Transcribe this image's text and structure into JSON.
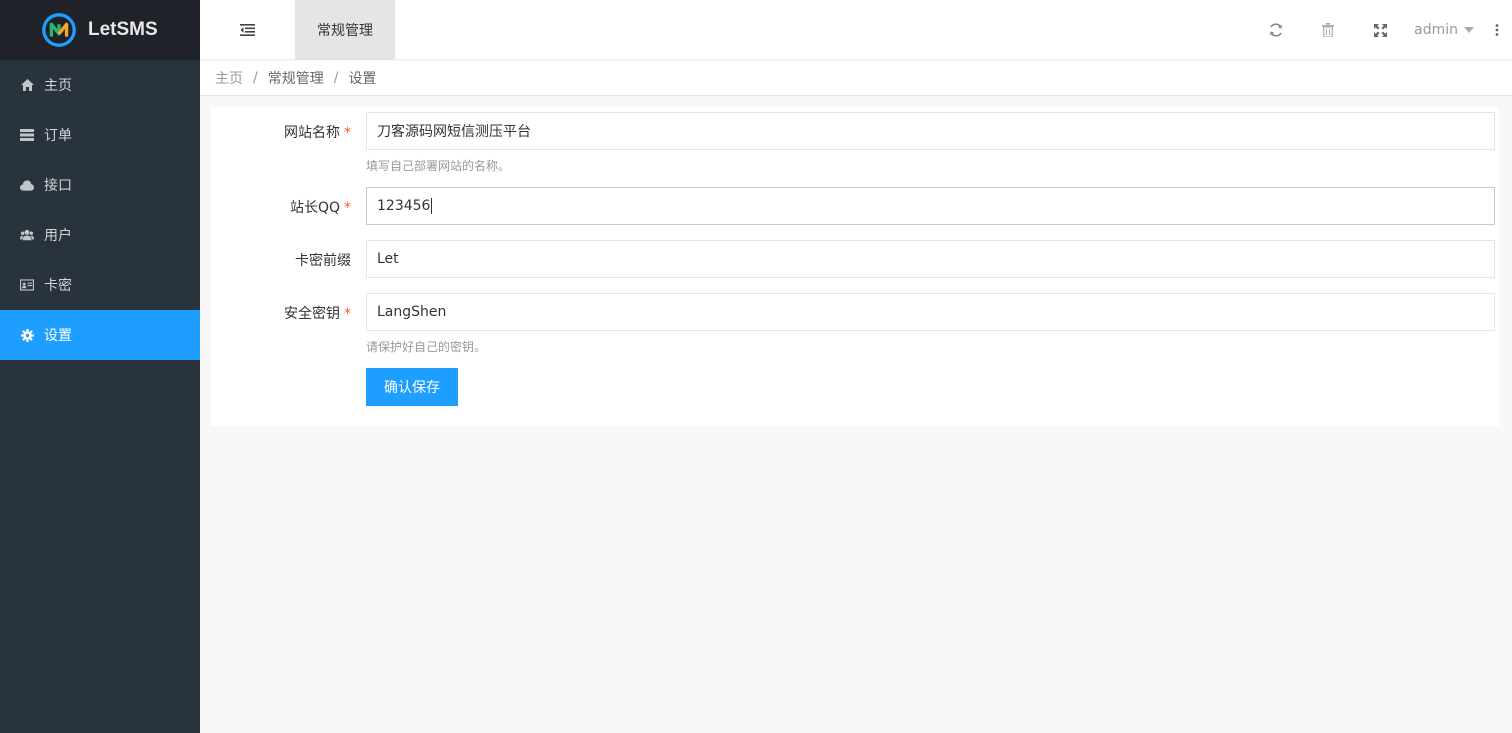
{
  "app": {
    "name": "LetSMS"
  },
  "sidebar": {
    "items": [
      {
        "label": "主页",
        "icon": "home-icon"
      },
      {
        "label": "订单",
        "icon": "list-icon"
      },
      {
        "label": "接口",
        "icon": "cloud-icon"
      },
      {
        "label": "用户",
        "icon": "users-icon"
      },
      {
        "label": "卡密",
        "icon": "card-icon"
      },
      {
        "label": "设置",
        "icon": "gear-icon",
        "active": true
      }
    ],
    "active_color": "#1e9fff"
  },
  "header": {
    "active_tab": "常规管理",
    "user": "admin",
    "tools": [
      "refresh-icon",
      "trash-icon",
      "fullscreen-icon"
    ]
  },
  "breadcrumb": [
    "主页",
    "常规管理",
    "设置"
  ],
  "form": {
    "site_name": {
      "label": "网站名称",
      "required": "*",
      "value": "刀客源码网短信测压平台",
      "hint": "填写自己部署网站的名称。"
    },
    "owner_qq": {
      "label": "站长QQ",
      "required": "*",
      "value": "123456"
    },
    "card_prefix": {
      "label": "卡密前缀",
      "value": "Let"
    },
    "secret_key": {
      "label": "安全密钥",
      "required": "*",
      "value": "LangShen",
      "hint": "请保护好自己的密钥。"
    },
    "submit_label": "确认保存"
  }
}
